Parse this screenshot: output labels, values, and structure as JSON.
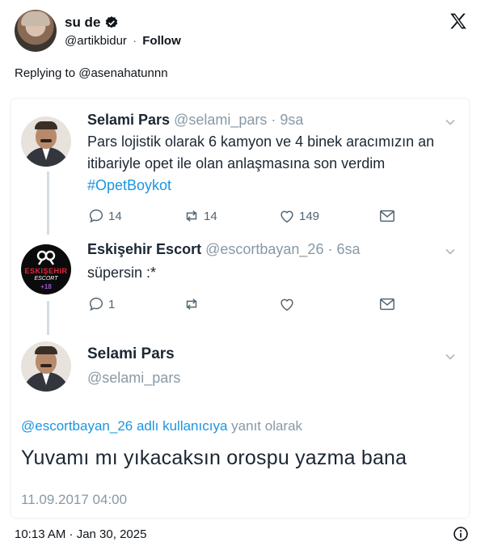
{
  "embed": {
    "author_name": "su de",
    "author_handle": "@artikbidur",
    "follow_label": "Follow",
    "separator": "·",
    "replying_prefix": "Replying to",
    "replying_handle": "@asenahatunnn",
    "timestamp": "10:13 AM · Jan 30, 2025",
    "icons": {
      "verified": "verified-badge-icon",
      "platform": "x-logo-icon",
      "info": "info-icon"
    }
  },
  "screenshot": {
    "tweets": [
      {
        "name": "Selami Pars",
        "handle": "@selami_pars",
        "time": "· 9sa",
        "body_text": "Pars lojistik olarak 6  kamyon ve 4 binek aracımızın an itibariyle opet ile olan anlaşmasına son verdim",
        "hashtag": "#OpetBoykot",
        "replies": "14",
        "retweets": "14",
        "likes": "149"
      },
      {
        "name": "Eskişehir Escort",
        "handle": "@escortbayan_26",
        "time": "· 6sa",
        "body_text": "süpersin :*",
        "replies": "1",
        "avatar_text": "ESKIŞEHIR",
        "avatar_subtext": "ESCORT",
        "avatar_badge": "+18"
      }
    ],
    "focused_tweet": {
      "name": "Selami Pars",
      "handle": "@selami_pars",
      "reply_mention": "@escortbayan_26 adlı kullanıcıya",
      "reply_suffix": "yanıt olarak",
      "text": "Yuvamı mı yıkacaksın orospu yazma bana",
      "date": "11.09.2017 04:00"
    },
    "colors": {
      "link": "#1b95e0",
      "muted": "#8899a6",
      "text": "#1c2733"
    }
  }
}
